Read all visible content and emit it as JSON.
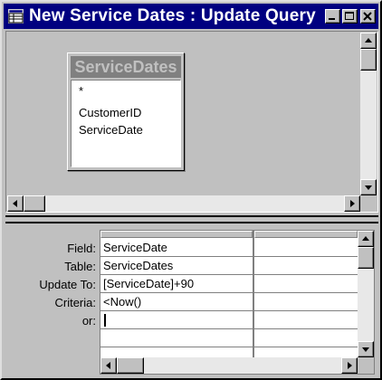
{
  "window": {
    "title": "New Service Dates : Update Query"
  },
  "table_pane": {
    "field_list": {
      "title": "ServiceDates",
      "items": [
        "*",
        "CustomerID",
        "ServiceDate"
      ]
    }
  },
  "design_grid": {
    "row_labels": [
      "Field:",
      "Table:",
      "Update To:",
      "Criteria:",
      "or:"
    ],
    "column_1": {
      "field": "ServiceDate",
      "table": "ServiceDates",
      "update_to": "[ServiceDate]+90",
      "criteria": "<Now()",
      "or": ""
    },
    "column_2": {
      "field": "",
      "table": "",
      "update_to": "",
      "criteria": "",
      "or": ""
    }
  },
  "icons": {
    "app": "query-icon",
    "minimize": "minimize-icon",
    "maximize": "maximize-icon",
    "close": "close-icon",
    "arrows": [
      "arrow-up-icon",
      "arrow-down-icon",
      "arrow-left-icon",
      "arrow-right-icon"
    ]
  },
  "colors": {
    "title_bar": "#000080",
    "face": "#c0c0c0",
    "field_list_title": "#808080"
  }
}
